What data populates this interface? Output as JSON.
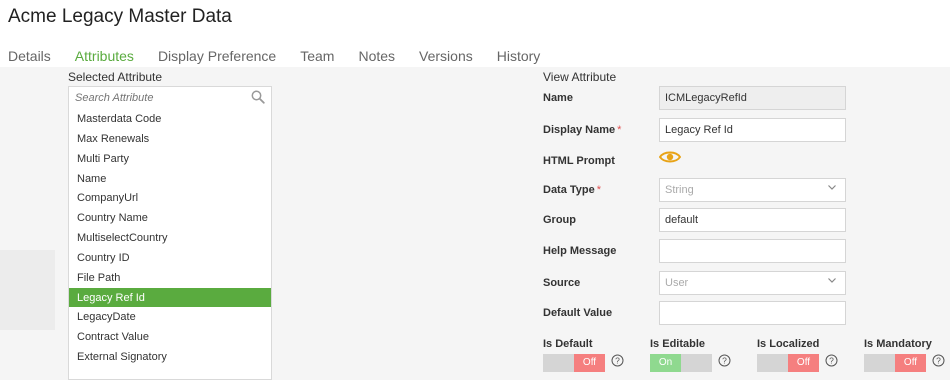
{
  "title": "Acme Legacy Master Data",
  "tabs": [
    {
      "label": "Details",
      "active": false
    },
    {
      "label": "Attributes",
      "active": true
    },
    {
      "label": "Display Preference",
      "active": false
    },
    {
      "label": "Team",
      "active": false
    },
    {
      "label": "Notes",
      "active": false
    },
    {
      "label": "Versions",
      "active": false
    },
    {
      "label": "History",
      "active": false
    }
  ],
  "left_panel": {
    "title": "Selected Attribute",
    "search_placeholder": "Search Attribute",
    "items": [
      {
        "label": "Masterdata Code",
        "selected": false
      },
      {
        "label": "Max Renewals",
        "selected": false
      },
      {
        "label": "Multi Party",
        "selected": false
      },
      {
        "label": "Name",
        "selected": false
      },
      {
        "label": "CompanyUrl",
        "selected": false
      },
      {
        "label": "Country Name",
        "selected": false
      },
      {
        "label": "MultiselectCountry",
        "selected": false
      },
      {
        "label": "Country ID",
        "selected": false
      },
      {
        "label": "File Path",
        "selected": false
      },
      {
        "label": "Legacy Ref Id",
        "selected": true
      },
      {
        "label": "LegacyDate",
        "selected": false
      },
      {
        "label": "Contract Value",
        "selected": false
      },
      {
        "label": "External Signatory",
        "selected": false
      }
    ]
  },
  "view": {
    "title": "View  Attribute",
    "name_label": "Name",
    "name_value": "ICMLegacyRefId",
    "display_name_label": "Display Name",
    "display_name_value": "Legacy Ref Id",
    "html_prompt_label": "HTML Prompt",
    "data_type_label": "Data Type",
    "data_type_value": "String",
    "group_label": "Group",
    "group_value": "default",
    "help_message_label": "Help Message",
    "help_message_value": "",
    "source_label": "Source",
    "source_value": "User",
    "default_value_label": "Default Value",
    "default_value_value": "",
    "required_mark": "*"
  },
  "toggles": [
    {
      "label": "Is Default",
      "state": "off",
      "on_text": "On",
      "off_text": "Off"
    },
    {
      "label": "Is Editable",
      "state": "on",
      "on_text": "On",
      "off_text": "Off"
    },
    {
      "label": "Is Localized",
      "state": "off",
      "on_text": "On",
      "off_text": "Off"
    },
    {
      "label": "Is Mandatory",
      "state": "off",
      "on_text": "On",
      "off_text": "Off"
    }
  ],
  "colors": {
    "accent_green": "#5aab3f",
    "eye_icon": "#e8a317",
    "toggle_on": "#8fd98f",
    "toggle_off": "#f57f7f",
    "required": "#e05050"
  },
  "icons": {
    "search": "search-icon",
    "eye": "eye-icon",
    "chevron": "chevron-down-icon",
    "help": "help-icon"
  }
}
